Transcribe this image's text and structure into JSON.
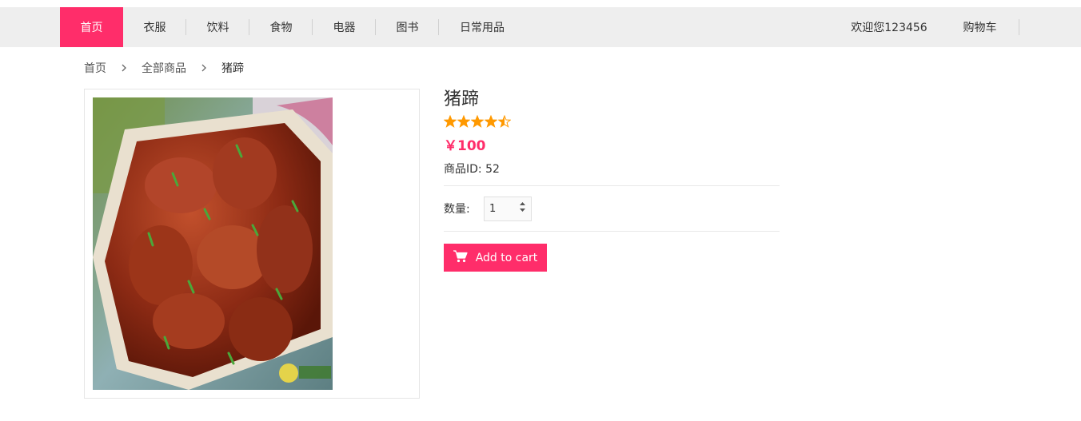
{
  "nav": {
    "items": [
      {
        "label": "首页",
        "active": true
      },
      {
        "label": "衣服"
      },
      {
        "label": "饮料"
      },
      {
        "label": "食物"
      },
      {
        "label": "电器"
      },
      {
        "label": "图书"
      },
      {
        "label": "日常用品"
      }
    ],
    "user_label": "欢迎您123456",
    "cart_label": "购物车"
  },
  "breadcrumb": {
    "home": "首页",
    "all": "全部商品",
    "current": "猪蹄"
  },
  "product": {
    "title": "猪蹄",
    "rating": 4.5,
    "price": "￥100",
    "id_text": "商品ID: 52",
    "image_icon": "braised-pork-trotters-photo"
  },
  "quantity": {
    "label": "数量:",
    "value": "1"
  },
  "add_to_cart": {
    "label": "Add to cart",
    "icon": "cart-icon"
  },
  "colors": {
    "accent": "#ff2d6a",
    "star": "#ff9900",
    "topbar": "#eeeeee"
  }
}
